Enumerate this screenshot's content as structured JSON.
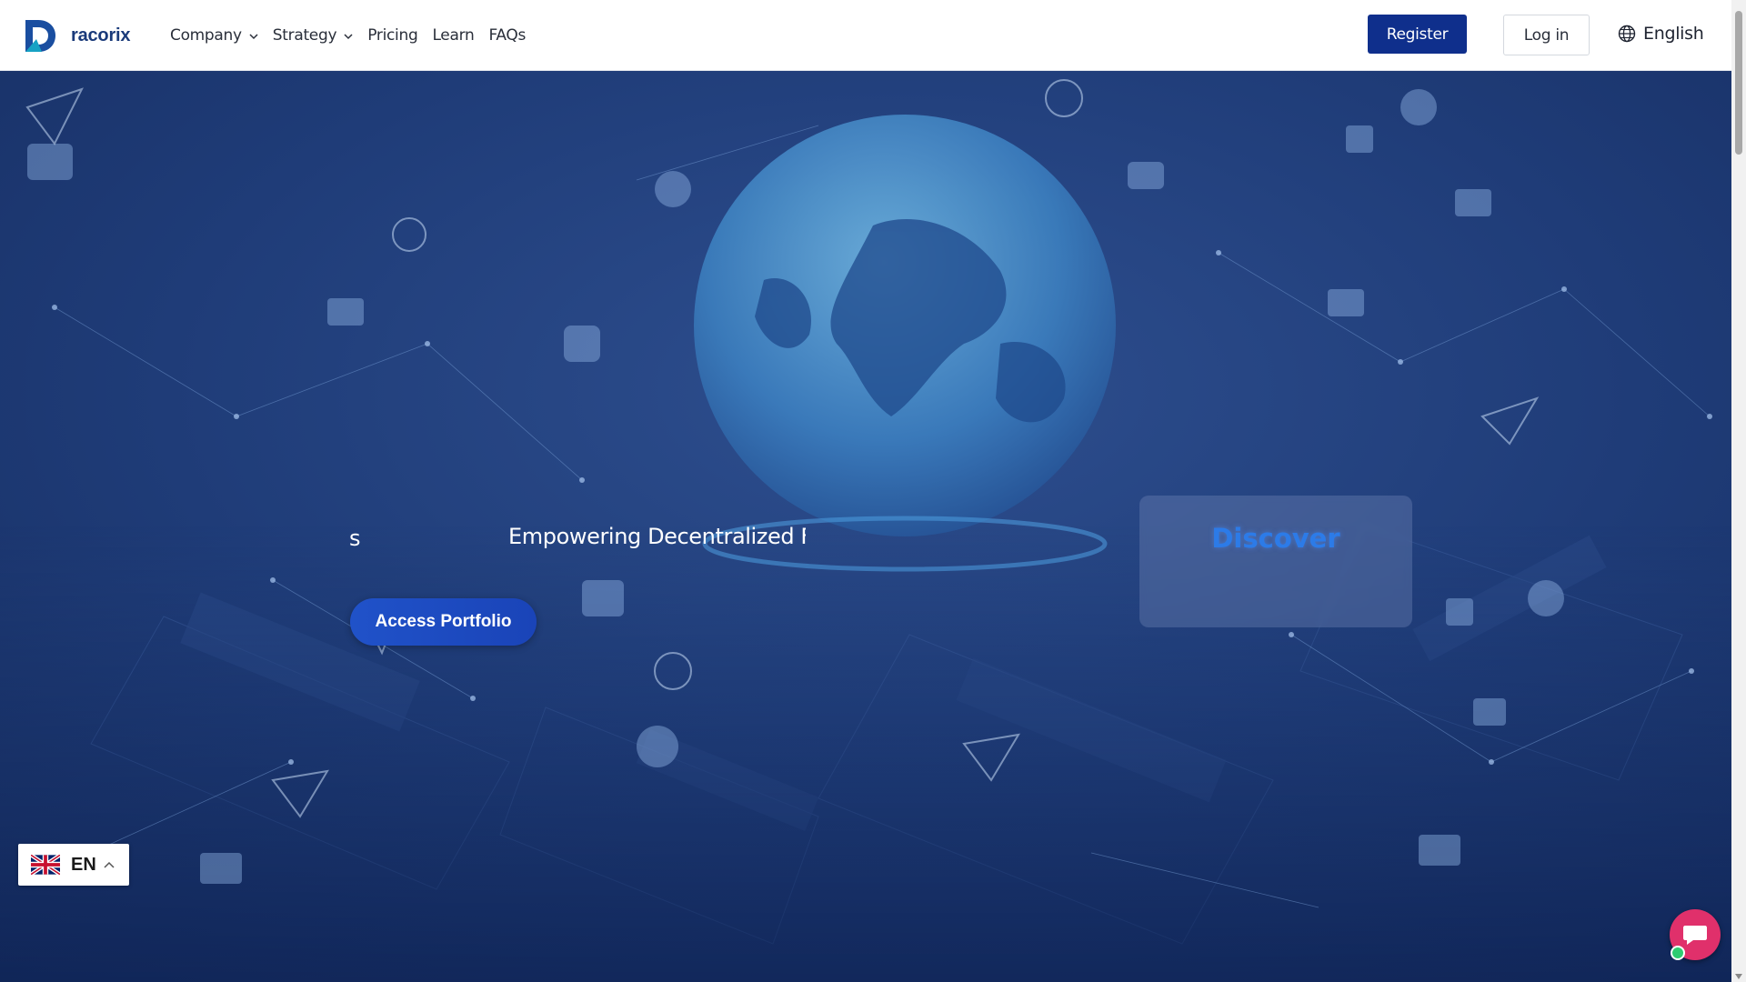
{
  "brand": {
    "name": "racorix"
  },
  "nav": {
    "items": [
      {
        "label": "Company",
        "has_dropdown": true
      },
      {
        "label": "Strategy",
        "has_dropdown": true
      },
      {
        "label": "Pricing",
        "has_dropdown": false
      },
      {
        "label": "Learn",
        "has_dropdown": false
      },
      {
        "label": "FAQs",
        "has_dropdown": false
      }
    ],
    "register_label": "Register",
    "login_label": "Log in",
    "language_label": "English",
    "language_icon": "globe-icon"
  },
  "hero": {
    "scroll_fragment": "s",
    "tagline": "Empowering Decentralized Finance",
    "access_button_label": "Access Portfolio",
    "discover_label": "Discover"
  },
  "language_widget": {
    "code": "EN",
    "flag_icon": "uk-flag-icon"
  },
  "chat": {
    "icon": "chat-bubble-icon",
    "status": "online"
  },
  "colors": {
    "brand_navy": "#0f2f8c",
    "hero_bg": "#1a3468",
    "accent_blue": "#2052c9",
    "discover_text": "#2c7be8",
    "chat_button": "#e0306b",
    "online": "#2ecc71"
  }
}
